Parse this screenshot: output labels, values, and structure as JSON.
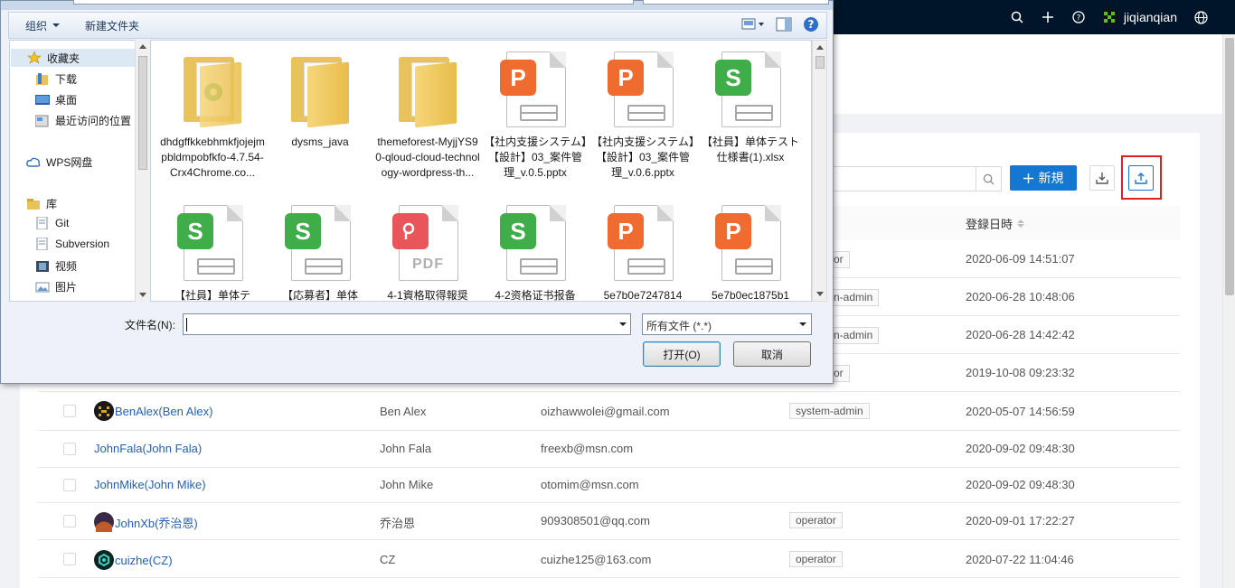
{
  "topbar": {
    "username": "jiqianqian"
  },
  "toolbar": {
    "new_label": "新規"
  },
  "table": {
    "date_header": "登録日時",
    "partial_rows": [
      {
        "role": "or",
        "date": "2020-06-09 14:51:07"
      },
      {
        "role": "n-admin",
        "date": "2020-06-28 10:48:06"
      },
      {
        "role": "n-admin",
        "date": "2020-06-28 14:42:42"
      },
      {
        "role": "or",
        "date": "2019-10-08 09:23:32"
      }
    ],
    "rows": [
      {
        "name": "BenAlex(Ben Alex)",
        "display": "Ben Alex",
        "email": "oizhawwolei@gmail.com",
        "role": "system-admin",
        "date": "2020-05-07 14:56:59",
        "avatar": true,
        "avcolor": "#2b2b2b"
      },
      {
        "name": "JohnFala(John Fala)",
        "display": "John Fala",
        "email": "freexb@msn.com",
        "role": "",
        "date": "2020-09-02 09:48:30",
        "avatar": false
      },
      {
        "name": "JohnMike(John Mike)",
        "display": "John Mike",
        "email": "otomim@msn.com",
        "role": "",
        "date": "2020-09-02 09:48:30",
        "avatar": false
      },
      {
        "name": "JohnXb(乔治恩)",
        "display": "乔治恩",
        "email": "909308501@qq.com",
        "role": "operator",
        "date": "2020-09-01 17:22:27",
        "avatar": true,
        "avcolor": "#b5542a"
      },
      {
        "name": "cuizhe(CZ)",
        "display": "CZ",
        "email": "cuizhe125@163.com",
        "role": "operator",
        "date": "2020-07-22 11:04:46",
        "avatar": true,
        "avcolor": "#0f2b2b"
      }
    ]
  },
  "dialog": {
    "organize": "组织",
    "new_folder": "新建文件夹",
    "nav": [
      "收藏夹",
      "下载",
      "桌面",
      "最近访问的位置",
      "WPS网盘",
      "库",
      "Git",
      "Subversion",
      "视频",
      "图片"
    ],
    "files": [
      {
        "name": "dhdgffkkebhmkfjojejmpbldmpobfkfo-4.7.54-Crx4Chrome.co...",
        "kind": "folder-app"
      },
      {
        "name": "dysms_java",
        "kind": "folder"
      },
      {
        "name": "themeforest-MyjjYS90-qloud-cloud-technology-wordpress-th...",
        "kind": "folder"
      },
      {
        "name": "【社内支援システム】【設計】03_案件管理_v.0.5.pptx",
        "kind": "ppt"
      },
      {
        "name": "【社内支援システム】【設計】03_案件管理_v.0.6.pptx",
        "kind": "ppt"
      },
      {
        "name": "【社員】单体テスト仕様書(1).xlsx",
        "kind": "xls"
      },
      {
        "name": "【社員】单体テ",
        "kind": "xls"
      },
      {
        "name": "【応募者】单体",
        "kind": "xls"
      },
      {
        "name": "4-1資格取得報奨",
        "kind": "pdf"
      },
      {
        "name": "4-2资格证书报备",
        "kind": "xls"
      },
      {
        "name": "5e7b0e7247814",
        "kind": "ppt"
      },
      {
        "name": "5e7b0ec1875b1",
        "kind": "ppt"
      }
    ],
    "filename_label": "文件名(N):",
    "filename_value": "",
    "filetype": "所有文件 (*.*)",
    "open_label": "打开(O)",
    "cancel_label": "取消"
  }
}
